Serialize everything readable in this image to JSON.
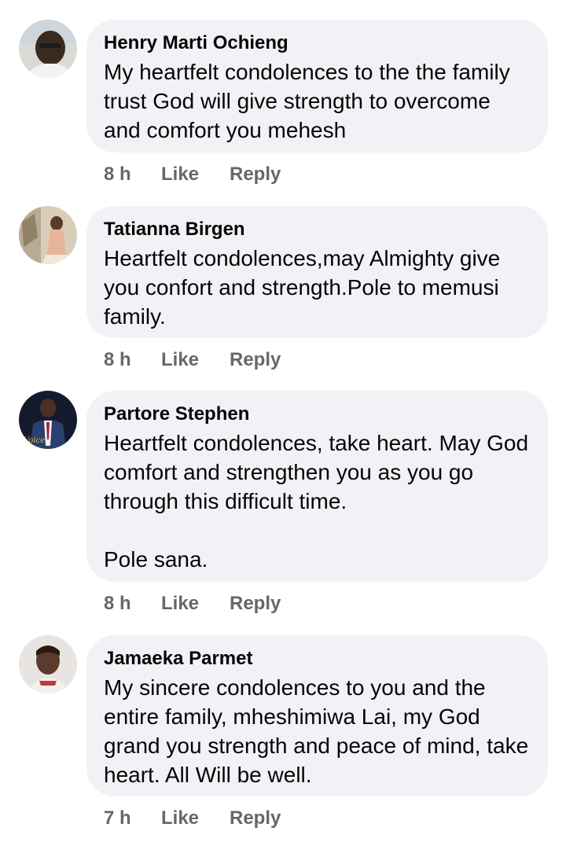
{
  "comments": [
    {
      "author": "Henry Marti Ochieng",
      "text": "My heartfelt condolences to the the family trust God will give strength to overcome and comfort you mehesh",
      "time": "8 h",
      "like_label": "Like",
      "reply_label": "Reply"
    },
    {
      "author": "Tatianna Birgen",
      "text": "Heartfelt condolences,may Almighty give you confort and strength.Pole to memusi family.",
      "time": "8 h",
      "like_label": "Like",
      "reply_label": "Reply"
    },
    {
      "author": "Partore Stephen",
      "text": "Heartfelt condolences, take heart. May God comfort and strengthen you as you go through this difficult time.\n\nPole sana.",
      "time": "8 h",
      "like_label": "Like",
      "reply_label": "Reply"
    },
    {
      "author": "Jamaeka Parmet",
      "text": "My sincere condolences to you and the entire family, mheshimiwa Lai, my God grand you strength and peace of mind, take heart. All Will be well.",
      "time": "7 h",
      "like_label": "Like",
      "reply_label": "Reply"
    }
  ],
  "colors": {
    "bubble": "#f0f2f5",
    "author": "#050505",
    "meta": "#65676b"
  }
}
